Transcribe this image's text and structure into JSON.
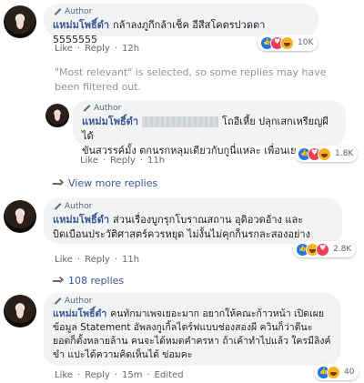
{
  "common": {
    "author_badge": "Author",
    "like": "Like",
    "reply": "Reply",
    "dot": "·"
  },
  "comments": [
    {
      "name": "แหม่มโพธิ์ดำ",
      "text": "กล้าลงภูกีกล้าเช็ค อีสีสโคตรปวดตา 5555555",
      "time": "12h",
      "reactions": [
        "like-icon",
        "love-icon",
        "haha-icon"
      ],
      "reaction_count": "10K"
    },
    {
      "name": "แหม่มโพธิ์ดำ",
      "text": "ขันสวรรค์มั้ง ตกนรกหลุมเดียวกับกูนี่แหละ เพื่อนเยอะดี",
      "text_prefix": "โถอีเหี้ย ปลุกเสกเหรียญผีได้",
      "time": "11h",
      "reactions": [
        "like-icon",
        "love-icon",
        "haha-icon"
      ],
      "reaction_count": "1.8K"
    },
    {
      "name": "แหม่มโพธิ์ดำ",
      "text": "ส่วนเรื่องบูกรุกโบราณสถาน อุดิอวดอ้าง และบิดเบือนประวัติศาสตร์ควรหยุด ไม่งั้นไม่คุกก็นรกละสองอย่าง",
      "time": "11h",
      "reactions": [
        "like-icon",
        "haha-icon",
        "love-icon"
      ],
      "reaction_count": "2.8K"
    },
    {
      "name": "แหม่มโพธิ์ดำ",
      "text": "คนทักมาเพจเยอะมาก อยากให้คณะก้าวหน้า เปิดเผยข้อมูล Statement อัพลงกูเกิ้ลไดร์ฟแบบช่องสองผี ควินก็ว่าดีนะ ยอดก็ตั้งหลายล้าน คนจะได้หมดคำครหา ถ้าเค้าทำไปแล้ว ใครมีลิงค์ขำ แปะได้ความคิดเห็นได้ ข่อมคะ",
      "time": "15m",
      "edited": "Edited",
      "reactions": [
        "like-icon",
        "haha-icon"
      ],
      "reaction_count": "40"
    }
  ],
  "notice": "\"Most relevant\" is selected, so some replies may have been filtered out.",
  "view_more_replies": "View more replies",
  "replies_108": "108 replies",
  "colors": {
    "name_link": "#385898",
    "bubble_bg": "#f2f3f5",
    "meta_text": "#606770"
  }
}
